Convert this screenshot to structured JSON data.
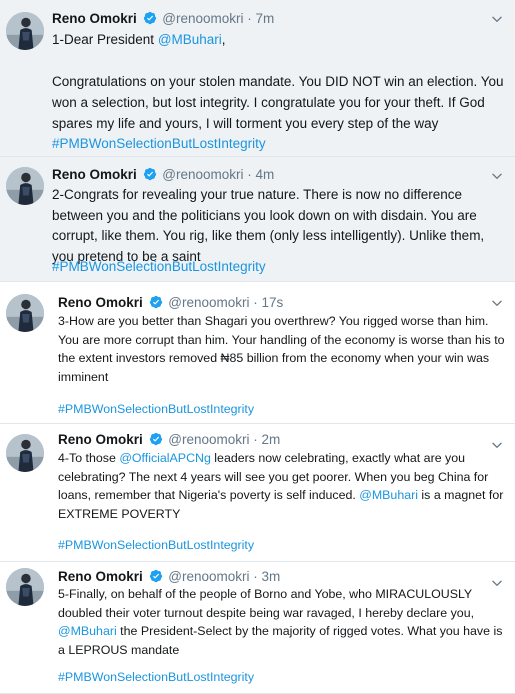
{
  "tweets": [
    {
      "author": "Reno Omokri",
      "handle": "@renoomokri",
      "time": "· 7m",
      "line1_pre": "1-Dear President ",
      "line1_mention": "@MBuhari",
      "line1_post": ",",
      "para2": "Congratulations on your stolen mandate. You DID NOT win an election. You won a selection, but lost integrity. I congratulate you for your theft. If God spares my life and yours, I will torment you every step of the way",
      "hashtag": "#PMBWonSelectionButLostIntegrity"
    },
    {
      "author": "Reno Omokri",
      "handle": "@renoomokri",
      "time": "· 4m",
      "text": "2-Congrats for revealing your true nature. There is now no difference between you and the politicians you look down on with disdain. You are corrupt, like them. You rig, like them (only less intelligently). Unlike them, you pretend to be a saint",
      "hashtag": "#PMBWonSelectionButLostIntegrity"
    },
    {
      "author": "Reno Omokri",
      "handle": "@renoomokri",
      "time": "· 17s",
      "text": "3-How are you better than Shagari you overthrew? You rigged worse than him. You are more corrupt than him. Your handling of the economy is worse than his to the extent investors removed ₦85 billion from the economy when your win was imminent",
      "hashtag": "#PMBWonSelectionButLostIntegrity"
    },
    {
      "author": "Reno Omokri",
      "handle": "@renoomokri",
      "time": "· 2m",
      "text_a": "4-To those ",
      "mention_a": "@OfficialAPCNg",
      "text_b": " leaders now celebrating, exactly what are you celebrating? The next 4 years will see you get poorer. When you beg China for loans, remember that Nigeria's poverty is self induced. ",
      "mention_b": "@MBuhari",
      "text_c": " is a magnet for EXTREME POVERTY",
      "hashtag": "#PMBWonSelectionButLostIntegrity"
    },
    {
      "author": "Reno Omokri",
      "handle": "@renoomokri",
      "time": "· 3m",
      "text_a": "5-Finally, on behalf of the people of Borno and Yobe, who MIRACULOUSLY doubled their voter turnout despite being war ravaged, I hereby declare you, ",
      "mention_a": "@MBuhari",
      "text_b": " the President-Select by the majority of rigged votes. What you have is a LEPROUS mandate",
      "hashtag": "#PMBWonSelectionButLostIntegrity"
    }
  ],
  "icons": {
    "verified": "verified-badge-icon",
    "chevron": "chevron-down-icon",
    "avatar": "profile-avatar"
  },
  "colors": {
    "link": "#1b95e0",
    "meta": "#657786",
    "text": "#14171a",
    "shaded_bg": "#eef2f5",
    "verified": "#1da1f2"
  }
}
